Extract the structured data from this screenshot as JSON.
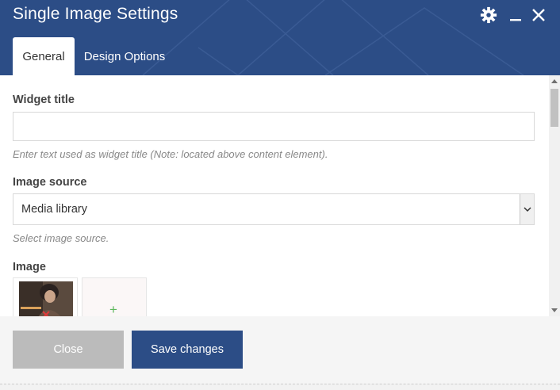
{
  "window": {
    "title": "Single Image Settings",
    "icons": [
      "gear-icon",
      "minimize-icon",
      "close-icon"
    ]
  },
  "tabs": [
    {
      "label": "General",
      "active": true
    },
    {
      "label": "Design Options",
      "active": false
    }
  ],
  "form": {
    "widget_title": {
      "label": "Widget title",
      "value": "",
      "help": "Enter text used as widget title (Note: located above content element)."
    },
    "image_source": {
      "label": "Image source",
      "selected": "Media library",
      "help": "Select image source."
    },
    "image": {
      "label": "Image",
      "add_symbol": "+"
    }
  },
  "footer": {
    "close_label": "Close",
    "save_label": "Save changes"
  },
  "colors": {
    "header": "#2c4d86",
    "save_button": "#2c4d86",
    "close_button": "#bbbbbb",
    "add_plus": "#5cb85c"
  }
}
